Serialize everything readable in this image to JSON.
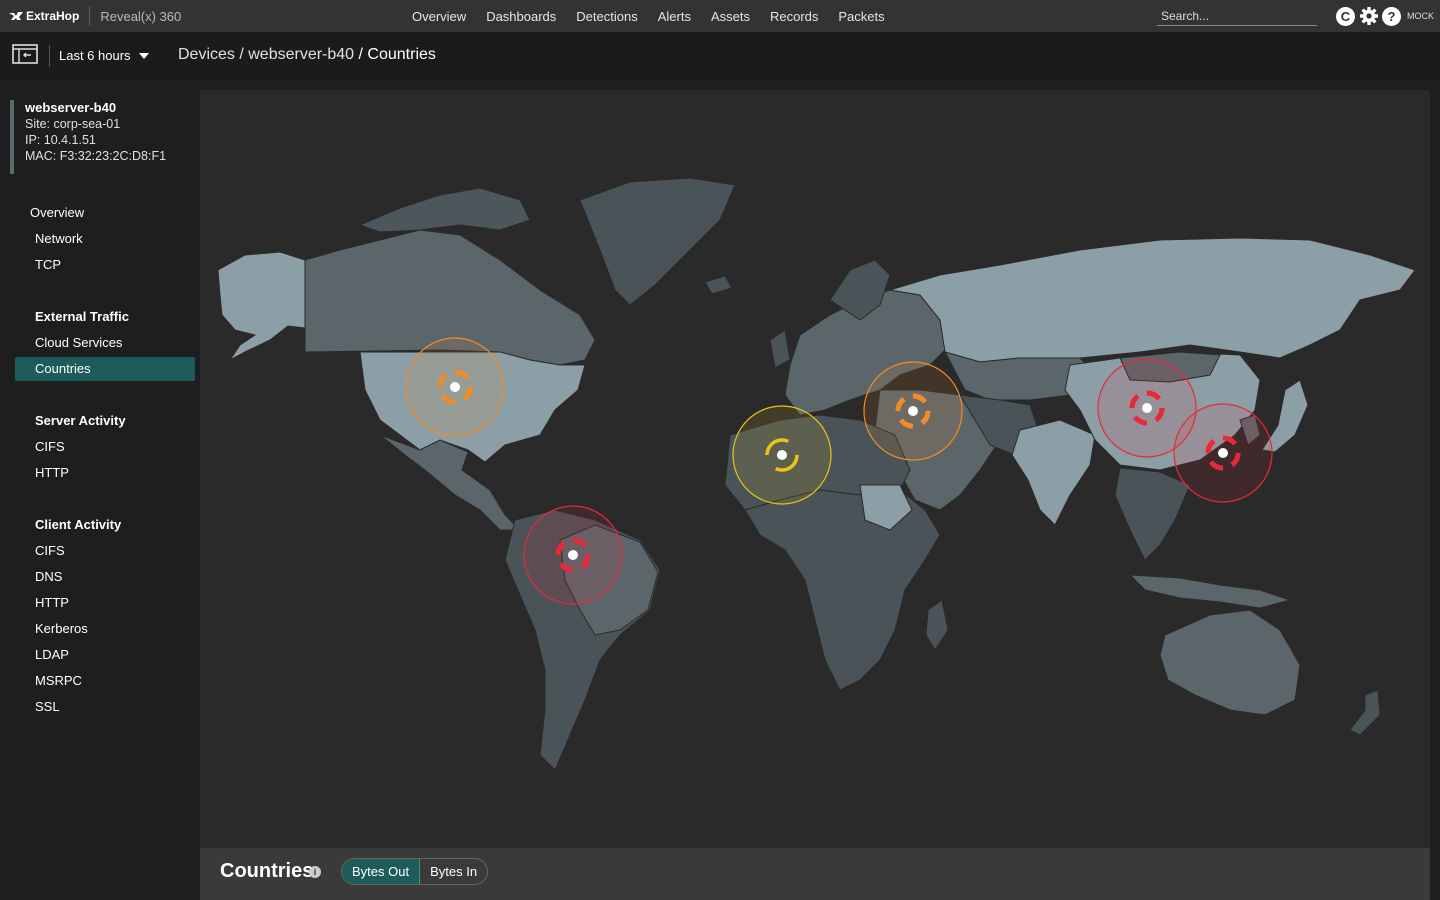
{
  "topbar": {
    "brand": "ExtraHop",
    "product": "Reveal(x) 360",
    "nav": [
      "Overview",
      "Dashboards",
      "Detections",
      "Alerts",
      "Assets",
      "Records",
      "Packets"
    ],
    "search_placeholder": "Search...",
    "refresh_icon_letter": "C",
    "help_icon_letter": "?",
    "mock_label": "MOCK",
    "icons": [
      "refresh-icon",
      "gear-icon",
      "help-icon"
    ]
  },
  "subbar": {
    "time_range": "Last 6 hours",
    "breadcrumb": [
      "Devices",
      " / webserver-b40",
      " / Countries"
    ]
  },
  "device": {
    "name": "webserver-b40",
    "site": "Site: corp-sea-01",
    "ip": "IP: 10.4.1.51",
    "mac": "MAC: F3:32:23:2C:D8:F1"
  },
  "sidebar": {
    "items": [
      {
        "label": "Overview",
        "type": "top"
      },
      {
        "label": "Network",
        "type": "item"
      },
      {
        "label": "TCP",
        "type": "item"
      },
      {
        "label": "External Traffic",
        "type": "heading"
      },
      {
        "label": "Cloud Services",
        "type": "item"
      },
      {
        "label": "Countries",
        "type": "item",
        "active": true
      },
      {
        "label": "Server Activity",
        "type": "heading"
      },
      {
        "label": "CIFS",
        "type": "item"
      },
      {
        "label": "HTTP",
        "type": "item"
      },
      {
        "label": "Client Activity",
        "type": "heading"
      },
      {
        "label": "CIFS",
        "type": "item"
      },
      {
        "label": "DNS",
        "type": "item"
      },
      {
        "label": "HTTP",
        "type": "item"
      },
      {
        "label": "Kerberos",
        "type": "item"
      },
      {
        "label": "LDAP",
        "type": "item"
      },
      {
        "label": "MSRPC",
        "type": "item"
      },
      {
        "label": "SSL",
        "type": "item"
      }
    ]
  },
  "map": {
    "markers": [
      {
        "region": "United States",
        "severity": "medium",
        "color": "#f28c28"
      },
      {
        "region": "Venezuela",
        "severity": "high",
        "color": "#e8293a"
      },
      {
        "region": "Algeria",
        "severity": "low",
        "color": "#e8c516"
      },
      {
        "region": "Turkey",
        "severity": "medium",
        "color": "#f28c28"
      },
      {
        "region": "China",
        "severity": "high",
        "color": "#e8293a"
      },
      {
        "region": "Japan",
        "severity": "high",
        "color": "#e8293a"
      }
    ]
  },
  "footer": {
    "title": "Countries",
    "info_icon_letter": "i",
    "toggle": [
      "Bytes Out",
      "Bytes In"
    ],
    "selected": "Bytes Out"
  },
  "colors": {
    "accent": "#1e5c5c",
    "land_light": "#8d9fa6",
    "land_dark": "#4a5357"
  }
}
